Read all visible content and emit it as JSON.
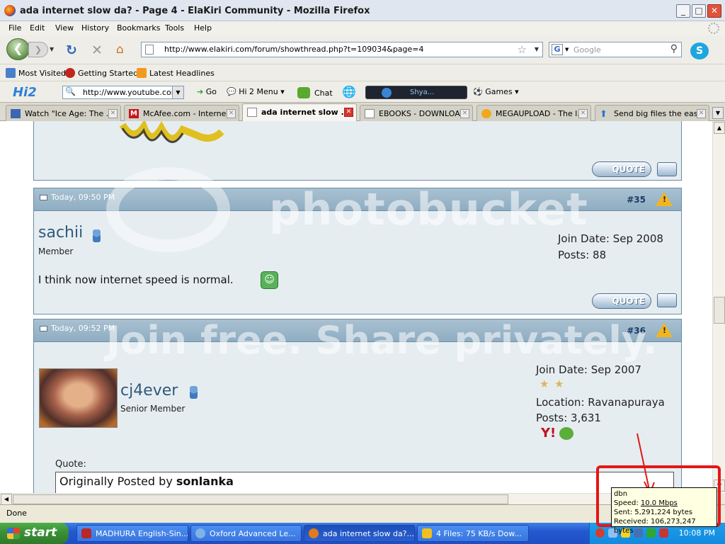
{
  "window": {
    "title": "ada internet slow da? - Page 4 - ElaKiri Community - Mozilla Firefox",
    "min": "_",
    "max": "□",
    "close": "✕"
  },
  "menu": [
    "File",
    "Edit",
    "View",
    "History",
    "Bookmarks",
    "Tools",
    "Help"
  ],
  "nav": {
    "url": "http://www.elakiri.com/forum/showthread.php?t=109034&page=4",
    "search_placeholder": "Google"
  },
  "bookmarks": [
    "Most Visited",
    "Getting Started",
    "Latest Headlines"
  ],
  "hi2": {
    "logo": "Hi2",
    "search_value": "http://www.youtube.com",
    "go": "Go",
    "menu": "Hi 2 Menu",
    "chat": "Chat",
    "media_title": "Shya...",
    "games": "Games"
  },
  "tabs": [
    {
      "label": "Watch \"Ice Age: The ...",
      "active": false
    },
    {
      "label": "McAfee.com - Interne...",
      "active": false
    },
    {
      "label": "ada internet slow ...",
      "active": true
    },
    {
      "label": "EBOOKS - DOWNLOA...",
      "active": false
    },
    {
      "label": "MEGAUPLOAD - The l...",
      "active": false
    },
    {
      "label": "Send big files the eas...",
      "active": false
    }
  ],
  "posts": [
    {
      "date": "Today, 09:50 PM",
      "number": "#35",
      "username": "sachii",
      "usertitle": "Member",
      "join_date": "Join Date: Sep 2008",
      "posts": "Posts: 88",
      "message": "I think now internet speed is normal."
    },
    {
      "date": "Today, 09:52 PM",
      "number": "#36",
      "username": "cj4ever",
      "usertitle": "Senior Member",
      "join_date": "Join Date: Sep 2007",
      "location": "Location: Ravanapuraya",
      "posts": "Posts: 3,631",
      "quote_label": "Quote:",
      "quote_text_prefix": "Originally Posted by ",
      "quote_author": "sonlanka"
    }
  ],
  "buttons": {
    "quote": "QUOTE"
  },
  "watermark": {
    "line1": "photobucket",
    "line2": "Join free. Share privately."
  },
  "status": "Done",
  "taskbar": {
    "start": "start",
    "tasks": [
      {
        "label": "MADHURA English-Sin...",
        "active": false
      },
      {
        "label": "Oxford Advanced Le...",
        "active": false
      },
      {
        "label": "ada internet slow da?...",
        "active": true
      },
      {
        "label": "4 Files: 75 KB/s Dow...",
        "active": false
      }
    ],
    "clock": "10:08 PM"
  },
  "tooltip": {
    "name": "dbn",
    "speed_label": "Speed: ",
    "speed": "10.0 Mbps",
    "sent": "Sent: 5,291,224 bytes",
    "received": "Received: 106,273,247 bytes"
  },
  "colors": {
    "annotation": "#e41616",
    "forum_header": "#8fadc2",
    "username": "#2f5a7a"
  }
}
